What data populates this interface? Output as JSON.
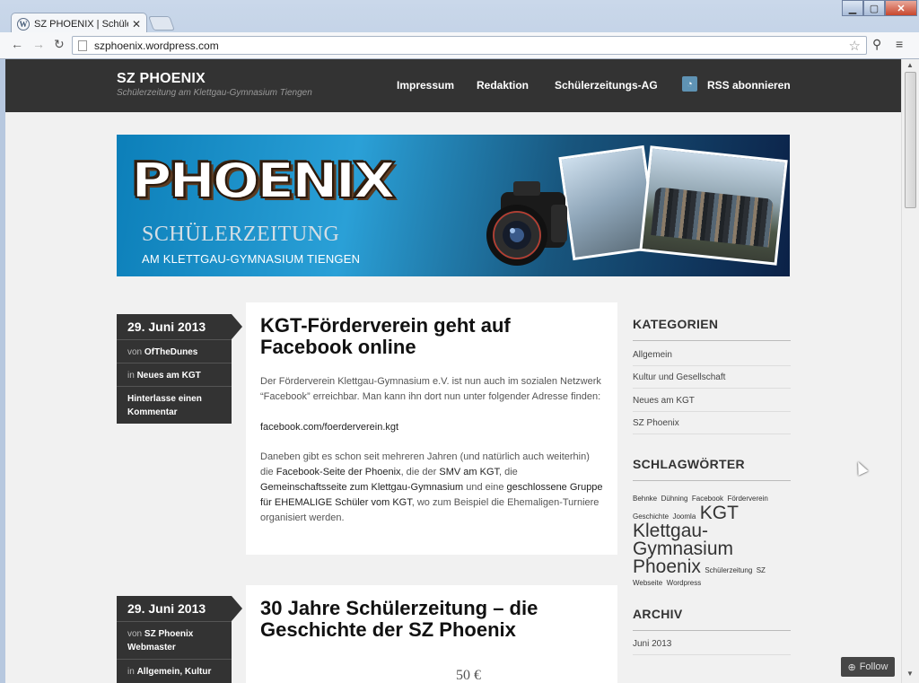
{
  "browser": {
    "tab_title": "SZ PHOENIX | Schülerzeitu",
    "tab_icon": "wordpress-icon",
    "url": "szphoenix.wordpress.com"
  },
  "site": {
    "title": "SZ PHOENIX",
    "tagline": "Schülerzeitung am Klettgau-Gymnasium Tiengen",
    "nav": [
      "Impressum",
      "Redaktion",
      "Schülerzeitungs-AG",
      "RSS abonnieren"
    ]
  },
  "banner": {
    "logo_text": "PHOENIX",
    "line1": "SCHÜLERZEITUNG",
    "line2": "AM KLETTGAU-GYMNASIUM TIENGEN"
  },
  "posts": [
    {
      "date": "29. Juni 2013",
      "author_label": "von",
      "author": "OfTheDunes",
      "cat_label": "in",
      "categories": "Neues am KGT",
      "comment": "Hinterlasse einen Kommentar",
      "title": "KGT-Förderverein geht auf Facebook online",
      "p1": "Der Förderverein Klettgau-Gymnasium e.V. ist nun auch im sozialen Netzwerk “Facebook” erreichbar. Man kann ihn dort nun unter folgender Adresse finden:",
      "p2": "facebook.com/foerderverein.kgt",
      "p3a": "Daneben gibt es schon seit mehreren Jahren (und natürlich auch weiterhin) die ",
      "p3_link1": "Facebook-Seite der Phoenix",
      "p3b": ", die der ",
      "p3_link2": "SMV am KGT",
      "p3c": ", die ",
      "p3_link3": "Gemeinschaftsseite zum Klettgau-Gymnasium",
      "p3d": " und eine ",
      "p3_link4": "geschlossene Gruppe für EHEMALIGE Schüler vom KGT",
      "p3e": ", wo zum Beispiel die Ehemaligen-Turniere organisiert werden."
    },
    {
      "date": "29. Juni 2013",
      "author_label": "von",
      "author": "SZ Phoenix Webmaster",
      "cat_label": "in",
      "categories": "Allgemein, Kultur",
      "title": "30 Jahre Schülerzeitung – die Geschichte der SZ Phoenix",
      "preview": "50 €"
    }
  ],
  "sidebar": {
    "categories_heading": "KATEGORIEN",
    "categories": [
      "Allgemein",
      "Kultur und Gesellschaft",
      "Neues am KGT",
      "SZ Phoenix"
    ],
    "tags_heading": "SCHLAGWÖRTER",
    "tags": {
      "t1": "Behnke",
      "t2": "Dühning",
      "t3": "Facebook",
      "t4": "Förderverein",
      "t5": "Geschichte",
      "t6": "Joomla",
      "t7": "KGT",
      "t8": "Klettgau-",
      "t9": "Gymnasium",
      "t10": "Phoenix",
      "t11": "Schülerzeitung",
      "t12": "SZ",
      "t13": "Webseite",
      "t14": "Wordpress"
    },
    "archive_heading": "ARCHIV",
    "archive": [
      "Juni 2013"
    ]
  },
  "follow_label": "Follow"
}
